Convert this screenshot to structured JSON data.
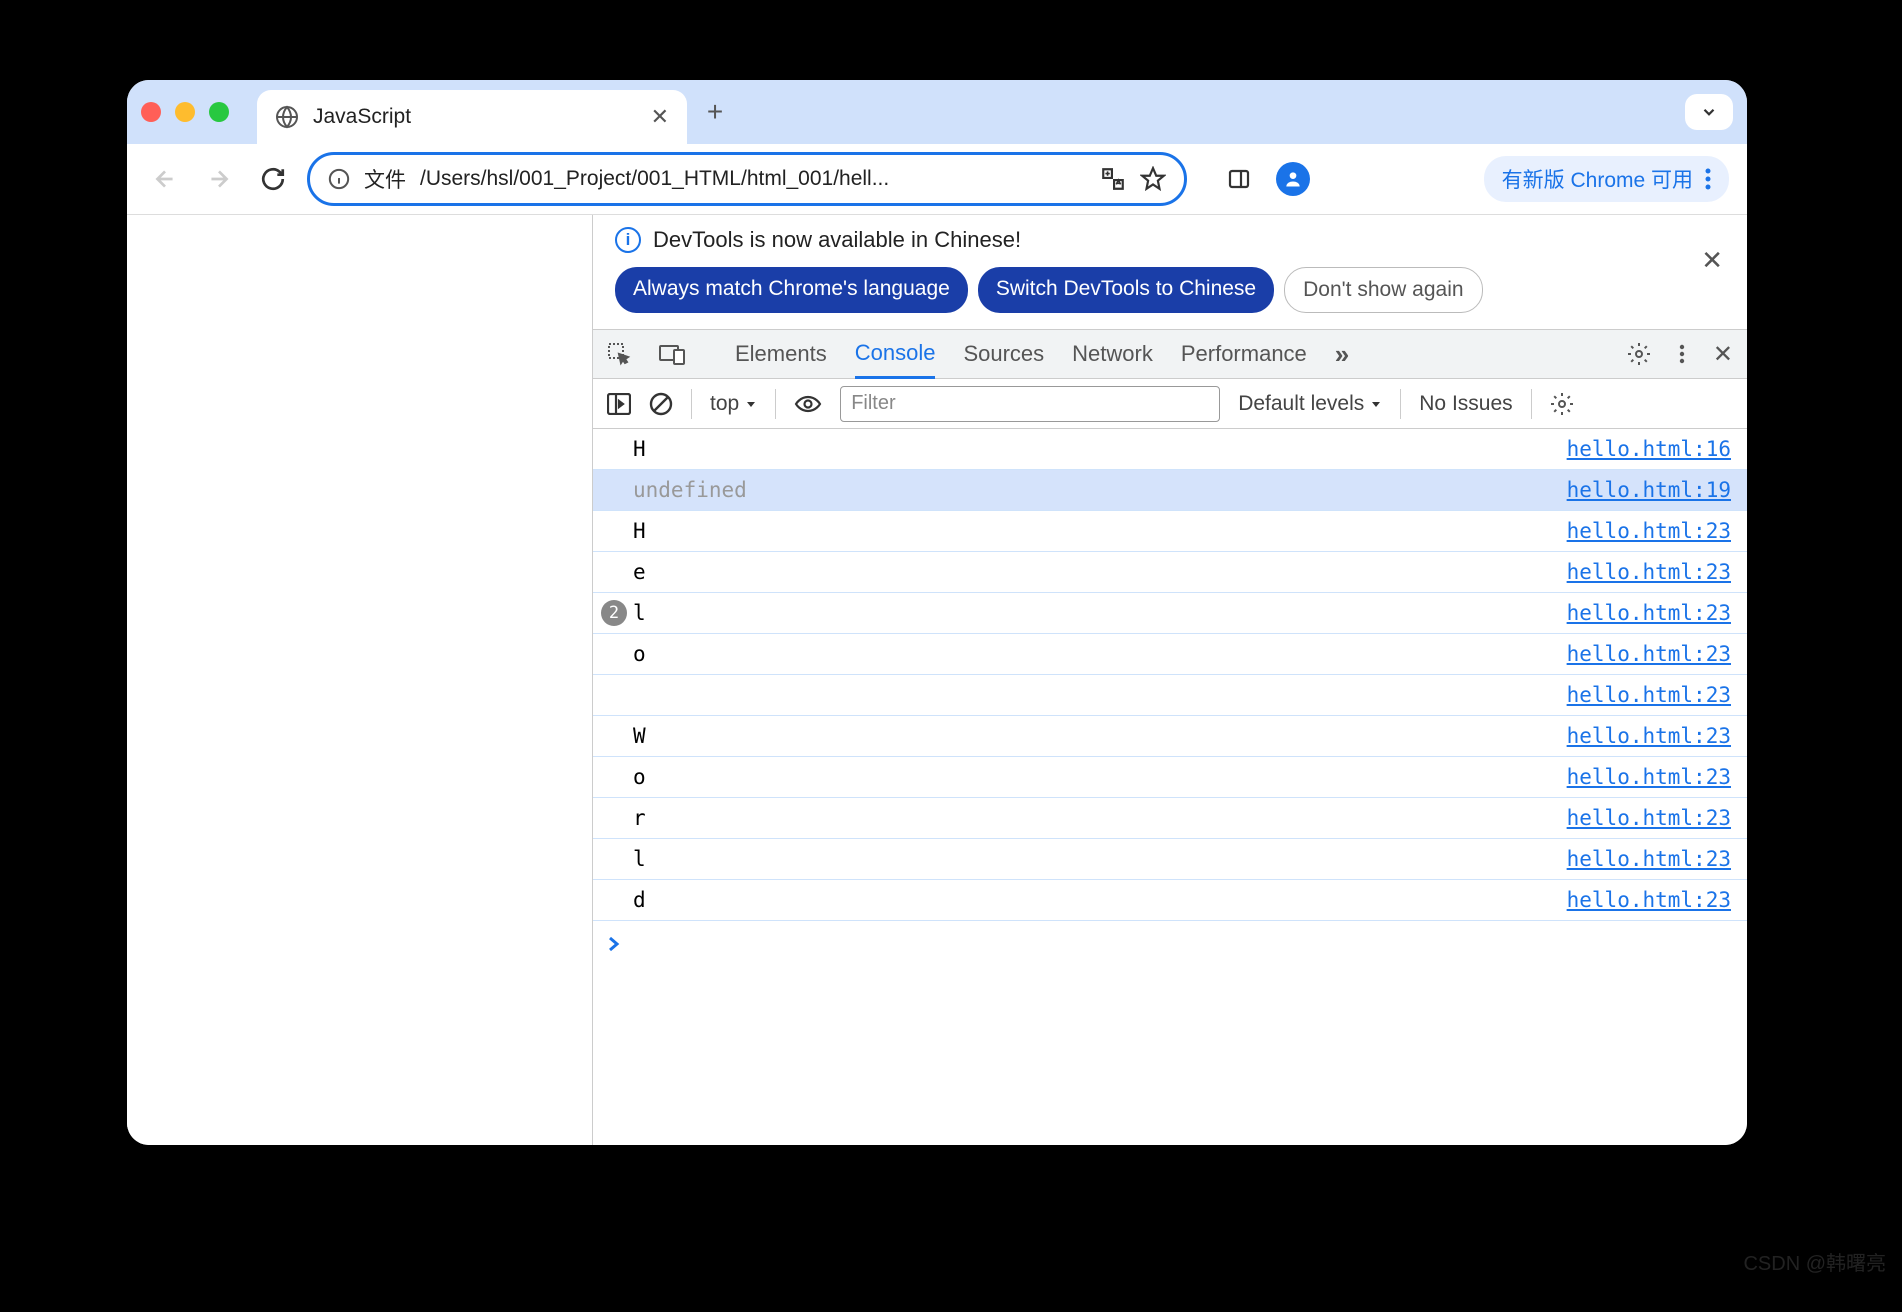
{
  "browser": {
    "tab_title": "JavaScript",
    "address_prefix": "文件",
    "address_path": "/Users/hsl/001_Project/001_HTML/html_001/hell...",
    "update_notice": "有新版 Chrome 可用"
  },
  "devtools": {
    "banner": {
      "text": "DevTools is now available in Chinese!",
      "match_btn": "Always match Chrome's language",
      "switch_btn": "Switch DevTools to Chinese",
      "dismiss_btn": "Don't show again"
    },
    "tabs": {
      "elements": "Elements",
      "console": "Console",
      "sources": "Sources",
      "network": "Network",
      "performance": "Performance"
    },
    "subbar": {
      "context": "top",
      "filter_placeholder": "Filter",
      "levels": "Default levels",
      "issues": "No Issues"
    },
    "rows": [
      {
        "msg": "H",
        "src": "hello.html:16"
      },
      {
        "msg": "undefined",
        "src": "hello.html:19",
        "dim": true,
        "hl": true
      },
      {
        "msg": "H",
        "src": "hello.html:23"
      },
      {
        "msg": "e",
        "src": "hello.html:23"
      },
      {
        "msg": "l",
        "src": "hello.html:23",
        "badge": "2"
      },
      {
        "msg": "o",
        "src": "hello.html:23"
      },
      {
        "msg": "",
        "src": "hello.html:23"
      },
      {
        "msg": "W",
        "src": "hello.html:23"
      },
      {
        "msg": "o",
        "src": "hello.html:23"
      },
      {
        "msg": "r",
        "src": "hello.html:23"
      },
      {
        "msg": "l",
        "src": "hello.html:23"
      },
      {
        "msg": "d",
        "src": "hello.html:23"
      }
    ]
  },
  "watermark": "CSDN @韩曙亮"
}
